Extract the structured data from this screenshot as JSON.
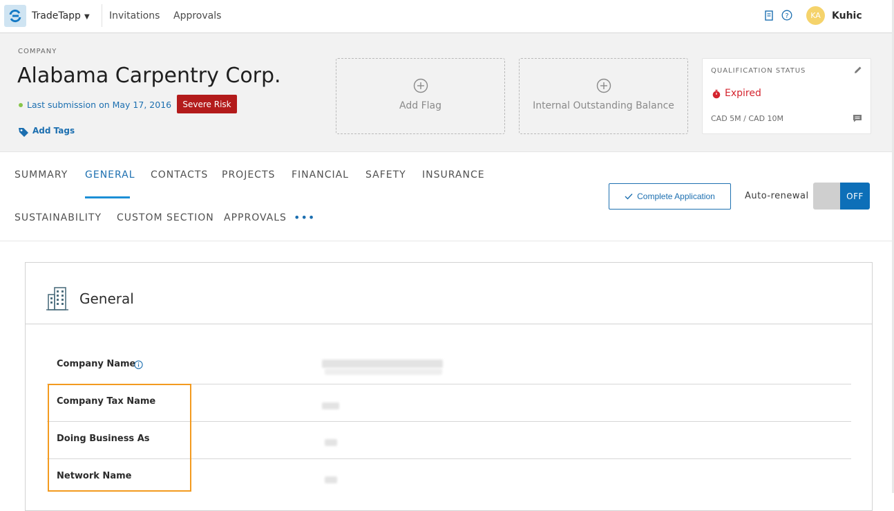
{
  "topbar": {
    "app_name": "TradeTapp",
    "nav": [
      "Invitations",
      "Approvals"
    ],
    "user_initials": "KA",
    "user_name": "Kuhic"
  },
  "header": {
    "company_label": "COMPANY",
    "company_name": "Alabama Carpentry Corp.",
    "last_submission": "Last submission on May 17, 2016",
    "risk_badge": "Severe Risk",
    "add_tags": "Add Tags",
    "add_flag": "Add Flag",
    "internal_balance": "Internal Outstanding Balance",
    "qualification": {
      "title": "QUALIFICATION STATUS",
      "status": "Expired",
      "amount": "CAD 5M / CAD 10M"
    }
  },
  "tabs": {
    "row1": [
      "SUMMARY",
      "GENERAL",
      "CONTACTS",
      "PROJECTS",
      "FINANCIAL",
      "SAFETY",
      "INSURANCE"
    ],
    "row2": [
      "SUSTAINABILITY",
      "CUSTOM SECTION",
      "APPROVALS"
    ],
    "active": "GENERAL",
    "more": "•••"
  },
  "actions": {
    "complete_application": "Complete Application",
    "auto_renewal_label": "Auto-renewal",
    "toggle_state": "OFF"
  },
  "general": {
    "title": "General",
    "fields": [
      {
        "label": "Company Name"
      },
      {
        "label": "Company Tax Name"
      },
      {
        "label": "Doing Business As"
      },
      {
        "label": "Network Name"
      }
    ]
  },
  "colors": {
    "accent": "#1c6fb0",
    "risk": "#b31b1b",
    "expired": "#d4242e",
    "highlight": "#f39a1f"
  }
}
